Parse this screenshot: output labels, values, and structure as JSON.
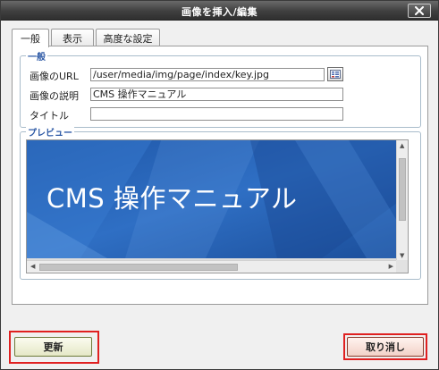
{
  "window": {
    "title": "画像を挿入/編集"
  },
  "tabs": [
    {
      "label": "一般",
      "active": true
    },
    {
      "label": "表示",
      "active": false
    },
    {
      "label": "高度な設定",
      "active": false
    }
  ],
  "general": {
    "legend": "一般",
    "url_label": "画像のURL",
    "url_value": "/user/media/img/page/index/key.jpg",
    "desc_label": "画像の説明",
    "desc_value": "CMS 操作マニュアル",
    "title_label": "タイトル",
    "title_value": ""
  },
  "preview": {
    "legend": "プレビュー",
    "image_text": "CMS 操作マニュアル"
  },
  "buttons": {
    "update": "更新",
    "cancel": "取り消し"
  },
  "colors": {
    "titlebar": "#3f3f3f",
    "legend": "#2e5aa6",
    "preview_bg": "#2a63b3",
    "highlight": "#e02020"
  }
}
